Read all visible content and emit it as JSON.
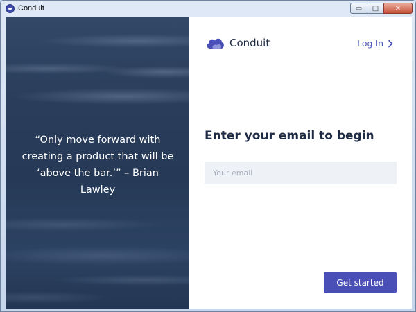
{
  "window": {
    "title": "Conduit",
    "controls": {
      "minimize": "▭",
      "maximize": "□",
      "close": "✕"
    }
  },
  "left": {
    "quote": "“Only move forward with creating a product that will be ‘above the bar.’” – Brian Lawley"
  },
  "right": {
    "brand": "Conduit",
    "login": "Log In",
    "heading": "Enter your email to begin",
    "email_placeholder": "Your email",
    "email_value": "",
    "cta": "Get started"
  },
  "colors": {
    "accent": "#4a4fb7",
    "link": "#4a54b6",
    "heading": "#1f2a44",
    "input_bg": "#eef1f6"
  },
  "icons": {
    "app": "conduit-app-icon",
    "brand": "cloud-icon",
    "login": "chevron-right-icon"
  }
}
